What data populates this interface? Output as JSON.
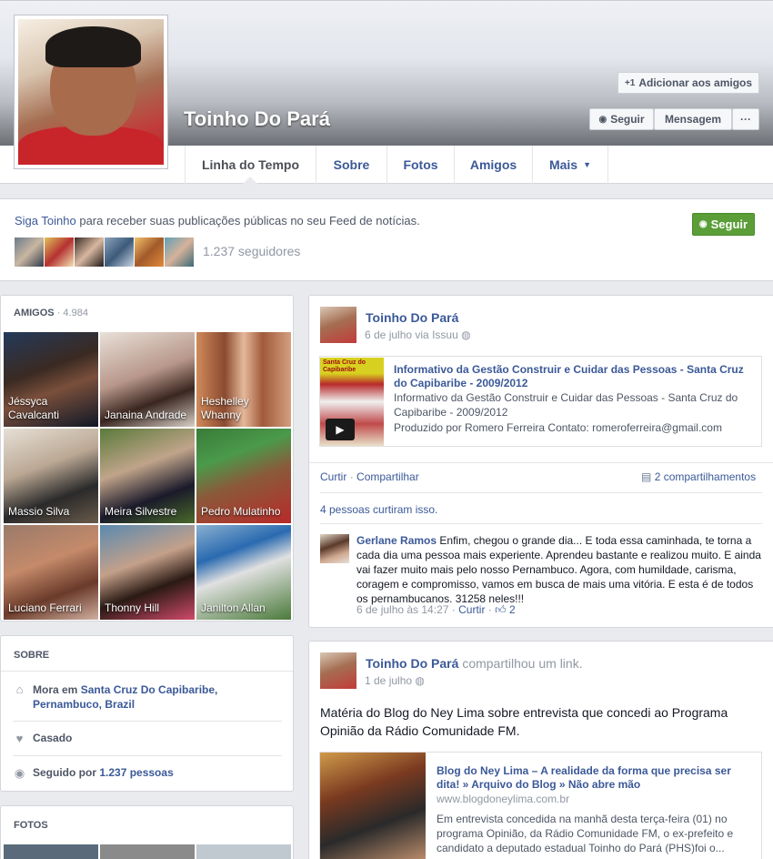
{
  "profile": {
    "name": "Toinho Do Pará",
    "add_friend_label": "Adicionar aos amigos",
    "follow_label": "Seguir",
    "message_label": "Mensagem",
    "more_label": "···"
  },
  "nav": {
    "tabs": [
      {
        "label": "Linha do Tempo"
      },
      {
        "label": "Sobre"
      },
      {
        "label": "Fotos"
      },
      {
        "label": "Amigos"
      },
      {
        "label": "Mais"
      }
    ]
  },
  "follow_box": {
    "link": "Siga Toinho",
    "text": "para receber suas publicações públicas no seu Feed de notícias.",
    "followers": "1.237 seguidores",
    "button": "Seguir"
  },
  "friends": {
    "title": "AMIGOS",
    "count": "· 4.984",
    "items": [
      {
        "name": "Jéssyca Cavalcanti"
      },
      {
        "name": "Janaina Andrade"
      },
      {
        "name": "Heshelley Whanny"
      },
      {
        "name": "Massio Silva"
      },
      {
        "name": "Meira Silvestre"
      },
      {
        "name": "Pedro Mulatinho"
      },
      {
        "name": "Luciano Ferrari"
      },
      {
        "name": "Thonny Hill"
      },
      {
        "name": "Janilton Allan"
      }
    ]
  },
  "about": {
    "title": "SOBRE",
    "lives_prefix": "Mora em",
    "lives_place": "Santa Cruz Do Capibaribe, Pernambuco, Brazil",
    "relationship": "Casado",
    "followed_prefix": "Seguido por",
    "followed_count": "1.237 pessoas"
  },
  "photos": {
    "title": "FOTOS"
  },
  "post1": {
    "author": "Toinho Do Pará",
    "date": "6 de julho",
    "via": "via Issuu",
    "link_title": "Informativo da Gestão Construir e Cuidar das Pessoas - Santa Cruz do Capibaribe - 2009/2012",
    "link_desc": "Informativo da Gestão Construir e Cuidar das Pessoas - Santa Cruz do Capibaribe - 2009/2012",
    "link_producer": "Produzido por Romero Ferreira Contato: romeroferreira@gmail.com",
    "thumb_caption": "Santa Cruz do Capibaribe",
    "like": "Curtir",
    "share": "Compartilhar",
    "shares": "2 compartilhamentos",
    "likes_text": "4 pessoas curtiram isso.",
    "comment_author": "Gerlane Ramos",
    "comment_text": "Enfim, chegou o grande dia... E toda essa caminhada, te torna a cada dia uma pessoa mais experiente. Aprendeu bastante e realizou muito. E ainda vai fazer muito mais pelo nosso Pernambuco. Agora, com humildade, carisma, coragem e compromisso, vamos em busca de mais uma vitória. E esta é de todos os pernambucanos. 31258 neles!!!",
    "comment_time": "6 de julho às 14:27",
    "comment_like": "Curtir",
    "comment_likes": "2"
  },
  "post2": {
    "author": "Toinho Do Pará",
    "action": "compartilhou um link.",
    "date": "1 de julho",
    "text": "Matéria do Blog do Ney Lima sobre entrevista que concedi ao Programa Opinião da Rádio Comunidade FM.",
    "link_title": "Blog do Ney Lima – A realidade da forma que precisa ser dita! » Arquivo do Blog » Não abre mão",
    "link_url": "www.blogdoneylima.com.br",
    "link_desc": "Em entrevista concedida na manhã desta terça-feira (01) no programa Opinião, da Rádio Comunidade FM, o ex-prefeito e candidato a deputado estadual Toinho do Pará (PHS)foi o..."
  }
}
